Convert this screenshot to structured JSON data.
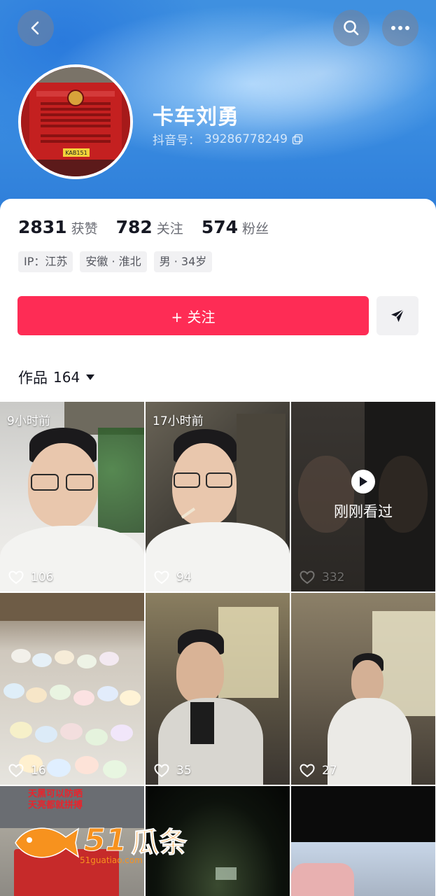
{
  "header": {
    "back_icon": "chevron-left-icon",
    "search_icon": "search-icon",
    "more_icon": "more-icon"
  },
  "profile": {
    "name": "卡车刘勇",
    "douyin_id_label": "抖音号：",
    "douyin_id": "39286778249",
    "plate_text": "KAB151"
  },
  "stats": [
    {
      "value": "2831",
      "label": "获赞"
    },
    {
      "value": "782",
      "label": "关注"
    },
    {
      "value": "574",
      "label": "粉丝"
    }
  ],
  "tags": [
    "IP：江苏",
    "安徽 · 淮北",
    "男 · 34岁"
  ],
  "actions": {
    "follow_label": "+ 关注",
    "dm_icon": "send-icon"
  },
  "works_tab": {
    "label": "作品",
    "count": "164"
  },
  "videos": [
    {
      "time": "9小时前",
      "likes": "106"
    },
    {
      "time": "17小时前",
      "likes": "94"
    },
    {
      "time": "",
      "likes": "332",
      "watched_label": "刚刚看过"
    },
    {
      "time": "",
      "likes": "16"
    },
    {
      "time": "",
      "likes": "35"
    },
    {
      "time": "",
      "likes": "27"
    },
    {
      "overlay_text": "天黑可以防晒\n天亮都就拼搏"
    }
  ],
  "watermark": {
    "logo": "51",
    "name": "瓜条",
    "url": "51guatiao.com"
  },
  "colors": {
    "accent": "#fe2c55",
    "banner": "#3c8fe2"
  }
}
